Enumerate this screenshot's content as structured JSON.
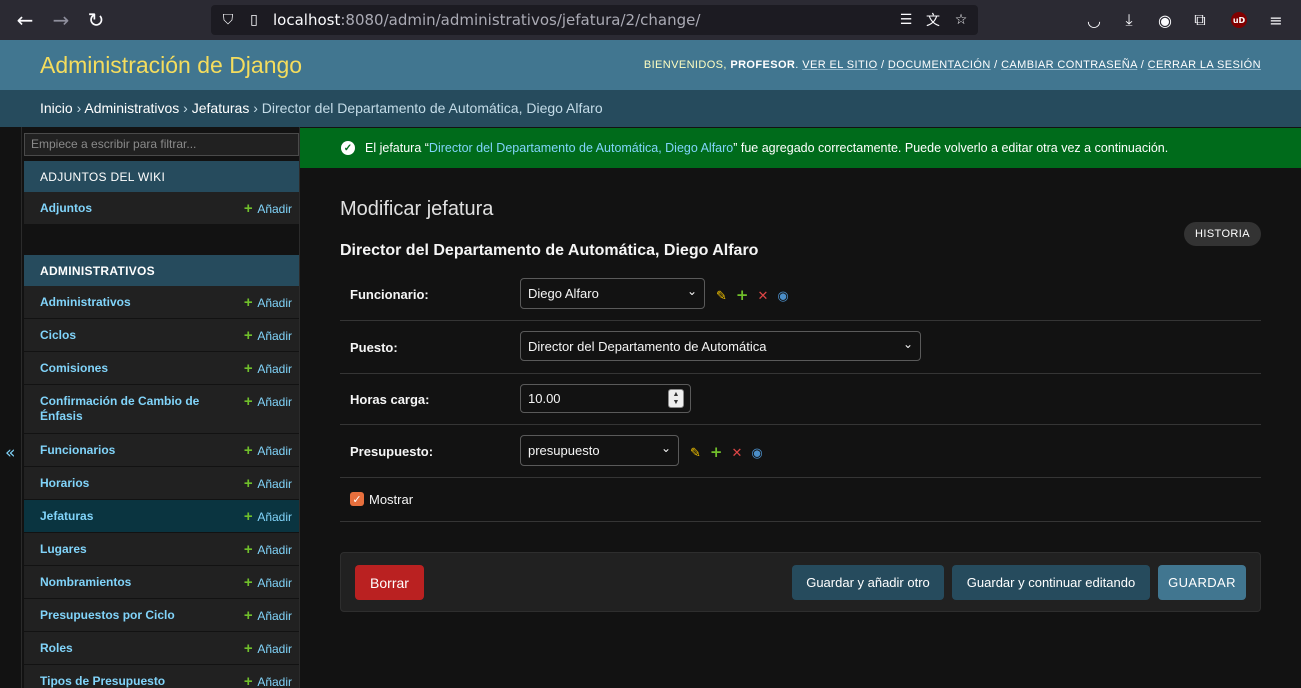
{
  "browser": {
    "url_host": "localhost",
    "url_rest": ":8080/admin/administrativos/jefatura/2/change/",
    "ublock_label": "uD"
  },
  "header": {
    "brand": "Administración de Django",
    "welcome": "BIENVENIDOS,",
    "user": "PROFESOR",
    "links": [
      "VER EL SITIO",
      "DOCUMENTACIÓN",
      "CAMBIAR CONTRASEÑA",
      "CERRAR LA SESIÓN"
    ]
  },
  "breadcrumbs": [
    "Inicio",
    "Administrativos",
    "Jefaturas",
    "Director del Departamento de Automática, Diego Alfaro"
  ],
  "sidebar": {
    "filter_placeholder": "Empiece a escribir para filtrar...",
    "add_label": "Añadir",
    "apps": [
      {
        "caption": "ADJUNTOS DEL WIKI",
        "models": [
          "Adjuntos"
        ]
      },
      {
        "caption": "ADMINISTRATIVOS",
        "models": [
          "Administrativos",
          "Ciclos",
          "Comisiones",
          "Confirmación de Cambio de Énfasis",
          "Funcionarios",
          "Horarios",
          "Jefaturas",
          "Lugares",
          "Nombramientos",
          "Presupuestos por Ciclo",
          "Roles",
          "Tipos de Presupuesto"
        ]
      }
    ],
    "active_model": "Jefaturas"
  },
  "message": {
    "prefix": "El jefatura “",
    "object": "Director del Departamento de Automática, Diego Alfaro",
    "suffix": "” fue agregado correctamente. Puede volverlo a editar otra vez a continuación."
  },
  "content": {
    "title": "Modificar jefatura",
    "history_label": "HISTORIA",
    "object_title": "Director del Departamento de Automática, Diego Alfaro",
    "fields": {
      "funcionario": {
        "label": "Funcionario:",
        "value": "Diego Alfaro"
      },
      "puesto": {
        "label": "Puesto:",
        "value": "Director del Departamento de Automática"
      },
      "horas_carga": {
        "label": "Horas carga:",
        "value": "10.00"
      },
      "presupuesto": {
        "label": "Presupuesto:",
        "value": "presupuesto"
      },
      "mostrar": {
        "label": "Mostrar",
        "checked": true
      }
    },
    "buttons": {
      "delete": "Borrar",
      "save_add": "Guardar y añadir otro",
      "save_continue": "Guardar y continuar editando",
      "save": "GUARDAR"
    }
  },
  "colors": {
    "header_bg": "#417690",
    "brand": "#f5dd5d",
    "breadcrumbs_bg": "#264b5d",
    "success_bg": "#006b1b",
    "link": "#81d4fa",
    "delete_bg": "#ba2121"
  }
}
